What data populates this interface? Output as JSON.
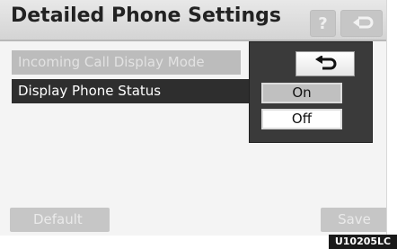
{
  "header": {
    "title": "Detailed Phone Settings",
    "help_label": "?",
    "back_icon": "return-arrow-icon"
  },
  "settings": [
    {
      "label": "Incoming Call Display Mode",
      "state": "disabled"
    },
    {
      "label": "Display Phone Status",
      "state": "selected"
    }
  ],
  "options_panel": {
    "back_icon": "return-arrow-icon",
    "options": [
      "On",
      "Off"
    ],
    "selected": "On"
  },
  "footer": {
    "default_label": "Default",
    "save_label": "Save"
  },
  "figure_code": "U10205LC",
  "colors": {
    "selected_row": "#2e2e2e",
    "panel": "#3a3a3a",
    "disabled_button": "#c6c6c6"
  }
}
